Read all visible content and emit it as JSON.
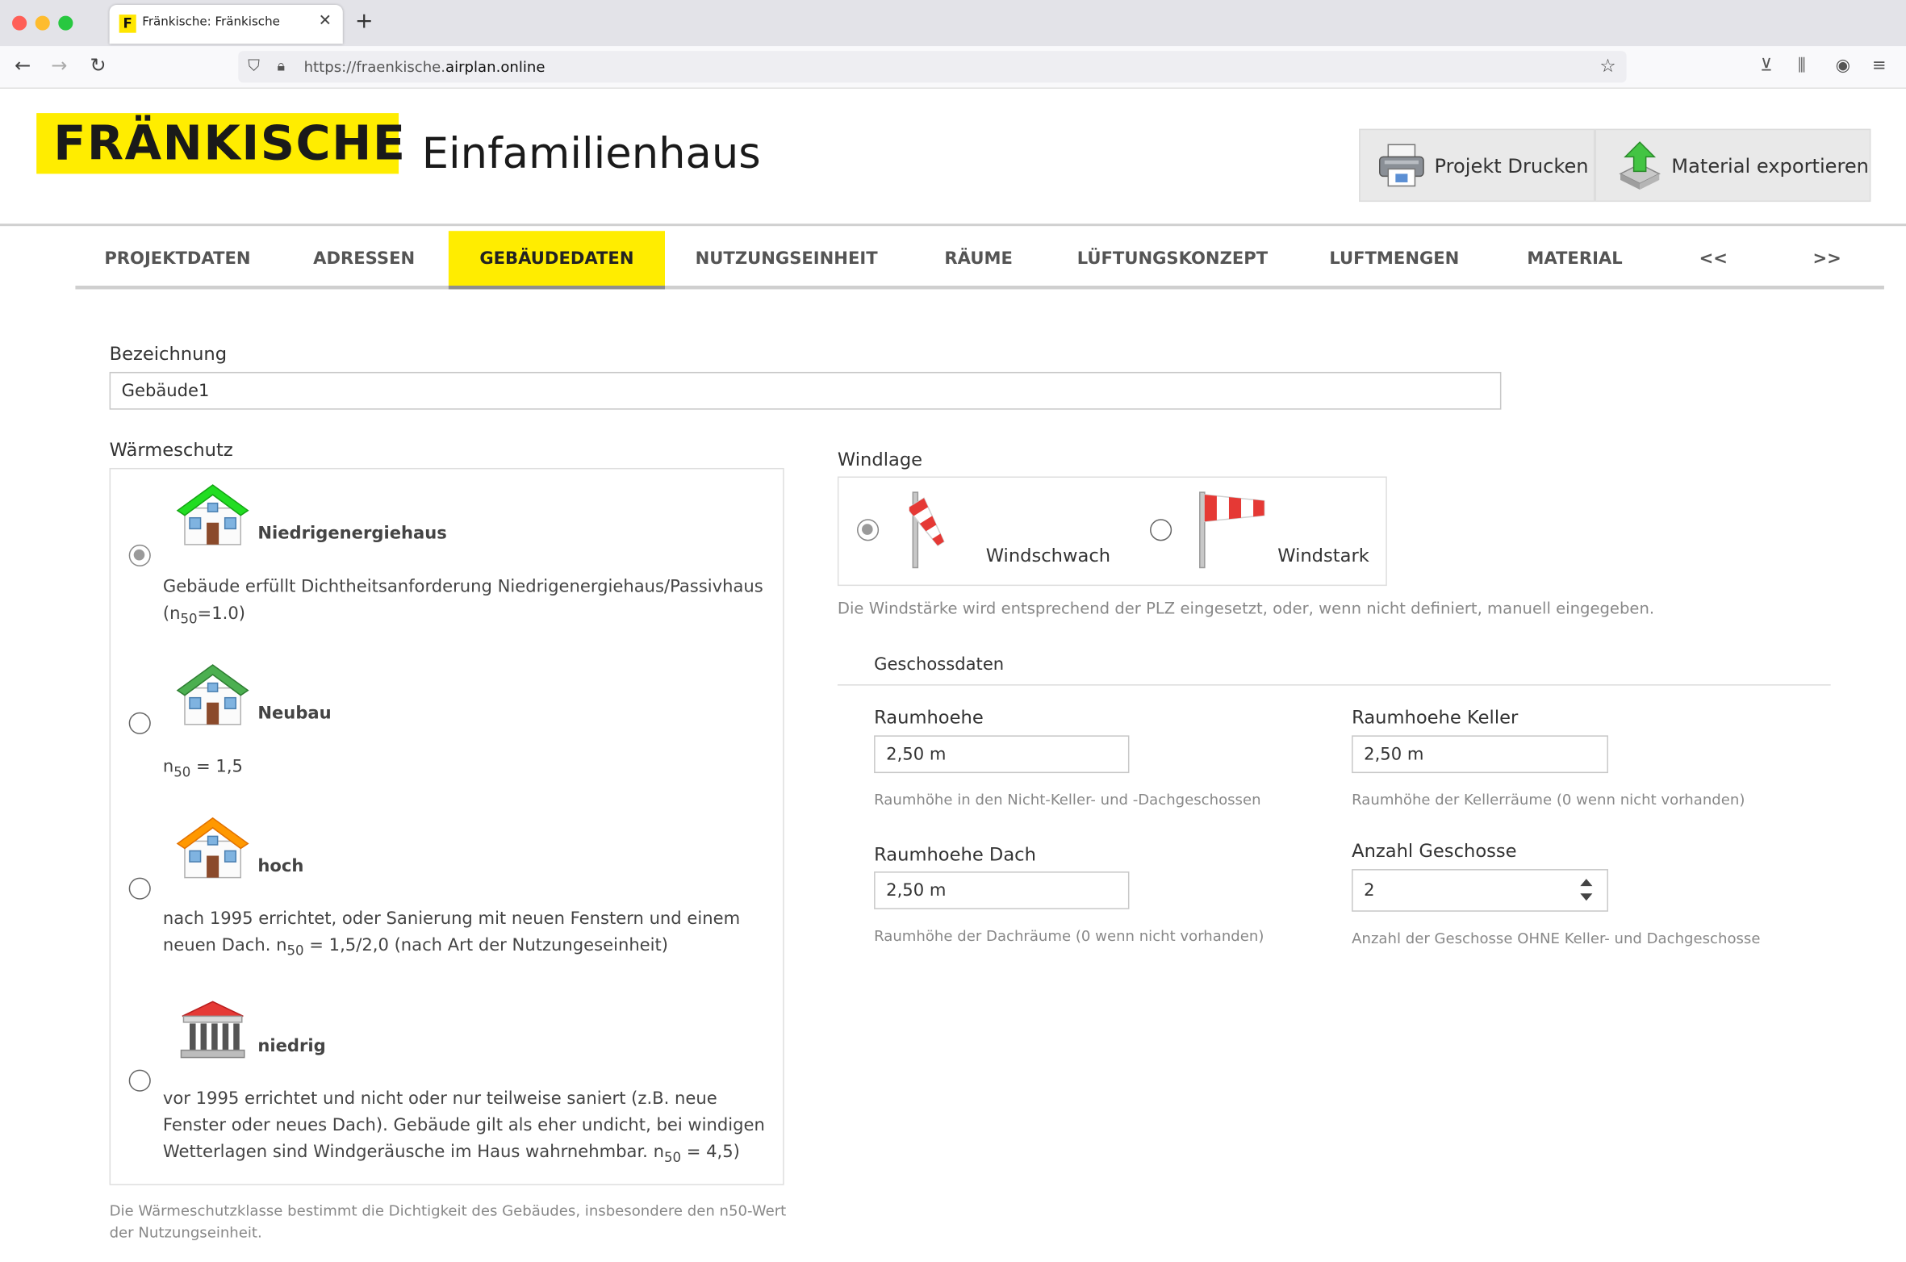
{
  "browser": {
    "tab_title": "Fränkische: Fränkische",
    "tab_favicon": "F",
    "url_prefix": "https://fraenkische.",
    "url_domain": "airplan.online"
  },
  "header": {
    "logo_text": "FRÄNKISCHE",
    "title": "Einfamilienhaus",
    "print_button": "Projekt Drucken",
    "export_button": "Material exportieren"
  },
  "tabs": [
    {
      "label": "PROJEKTDATEN"
    },
    {
      "label": "ADRESSEN"
    },
    {
      "label": "GEBÄUDEDATEN"
    },
    {
      "label": "NUTZUNGSEINHEIT"
    },
    {
      "label": "RÄUME"
    },
    {
      "label": "LÜFTUNGSKONZEPT"
    },
    {
      "label": "LUFTMENGEN"
    },
    {
      "label": "MATERIAL"
    },
    {
      "label": "<<"
    },
    {
      "label": ">>"
    }
  ],
  "form": {
    "bezeichnung_label": "Bezeichnung",
    "bezeichnung_value": "Gebäude1",
    "waermeschutz_label": "Wärmeschutz",
    "waermeschutz_options": [
      {
        "title": "Niedrigenergiehaus",
        "desc": "Gebäude erfüllt Dichtheitsanforderung Niedrigenergiehaus/Passivhaus",
        "n50_prefix": "(n",
        "n50_suffix": "=1.0)"
      },
      {
        "title": "Neubau",
        "n50_prefix": "n",
        "n50_suffix": " = 1,5"
      },
      {
        "title": "hoch",
        "desc": "nach 1995 errichtet, oder Sanierung mit neuen Fenstern und einem",
        "desc2_prefix": "neuen Dach. n",
        "desc2_suffix": " = 1,5/2,0 (nach Art der Nutzungeseinheit)"
      },
      {
        "title": "niedrig",
        "desc": "vor 1995 errichtet und nicht oder nur teilweise saniert (z.B. neue",
        "desc2": "Fenster oder neues Dach). Gebäude gilt als eher undicht, bei windigen",
        "desc3_prefix": "Wetterlagen sind Windgeräusche im Haus wahrnehmbar. n",
        "desc3_suffix": " = 4,5)"
      }
    ],
    "n50_sub": "50",
    "waermeschutz_help_1": "Die Wärmeschutzklasse bestimmt die Dichtigkeit des Gebäudes, insbesondere den n50-Wert",
    "waermeschutz_help_2": "der Nutzungseinheit.",
    "selected_waermeschutz": "Niedrigenergiehaus",
    "windlage_label": "Windlage",
    "windlage_options": [
      {
        "label": "Windschwach"
      },
      {
        "label": "Windstark"
      }
    ],
    "selected_windlage": "Windschwach",
    "windlage_help": "Die Windstärke wird entsprechend der PLZ eingesetzt, oder, wenn nicht definiert, manuell eingegeben.",
    "geschossdaten_title": "Geschossdaten",
    "raumhoehe_label": "Raumhoehe",
    "raumhoehe_value": "2,50 m",
    "raumhoehe_help": "Raumhöhe in den Nicht-Keller- und -Dachgeschossen",
    "raumhoehe_keller_label": "Raumhoehe Keller",
    "raumhoehe_keller_value": "2,50 m",
    "raumhoehe_keller_help": "Raumhöhe der Kellerräume (0 wenn nicht vorhanden)",
    "raumhoehe_dach_label": "Raumhoehe Dach",
    "raumhoehe_dach_value": "2,50 m",
    "raumhoehe_dach_help": "Raumhöhe der Dachräume (0 wenn nicht vorhanden)",
    "anzahl_geschosse_label": "Anzahl Geschosse",
    "anzahl_geschosse_value": "2",
    "anzahl_geschosse_help": "Anzahl der Geschosse OHNE Keller- und Dachgeschosse"
  },
  "colors": {
    "brand_yellow": "#ffed00",
    "house_green": "#22dd22",
    "house_darkgreen": "#4caf50",
    "house_orange": "#ff9800",
    "house_red": "#e53935"
  }
}
